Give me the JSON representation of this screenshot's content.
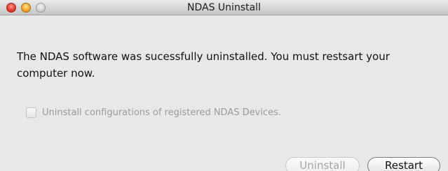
{
  "window": {
    "title": "NDAS Uninstall"
  },
  "message": "The NDAS software was sucessfully uninstalled. You must restsart your computer now.",
  "option": {
    "label": "Uninstall configurations of registered NDAS Devices.",
    "checked": false,
    "enabled": false
  },
  "buttons": {
    "uninstall_label": "Uninstall",
    "restart_label": "Restart"
  },
  "icons": {
    "close": "close-icon",
    "minimize": "minimize-icon",
    "zoom": "zoom-icon"
  },
  "colors": {
    "window_bg": "#e8e8e8",
    "close": "#f0463d",
    "minimize": "#f7b23a",
    "zoom": "#d8d8d8"
  }
}
